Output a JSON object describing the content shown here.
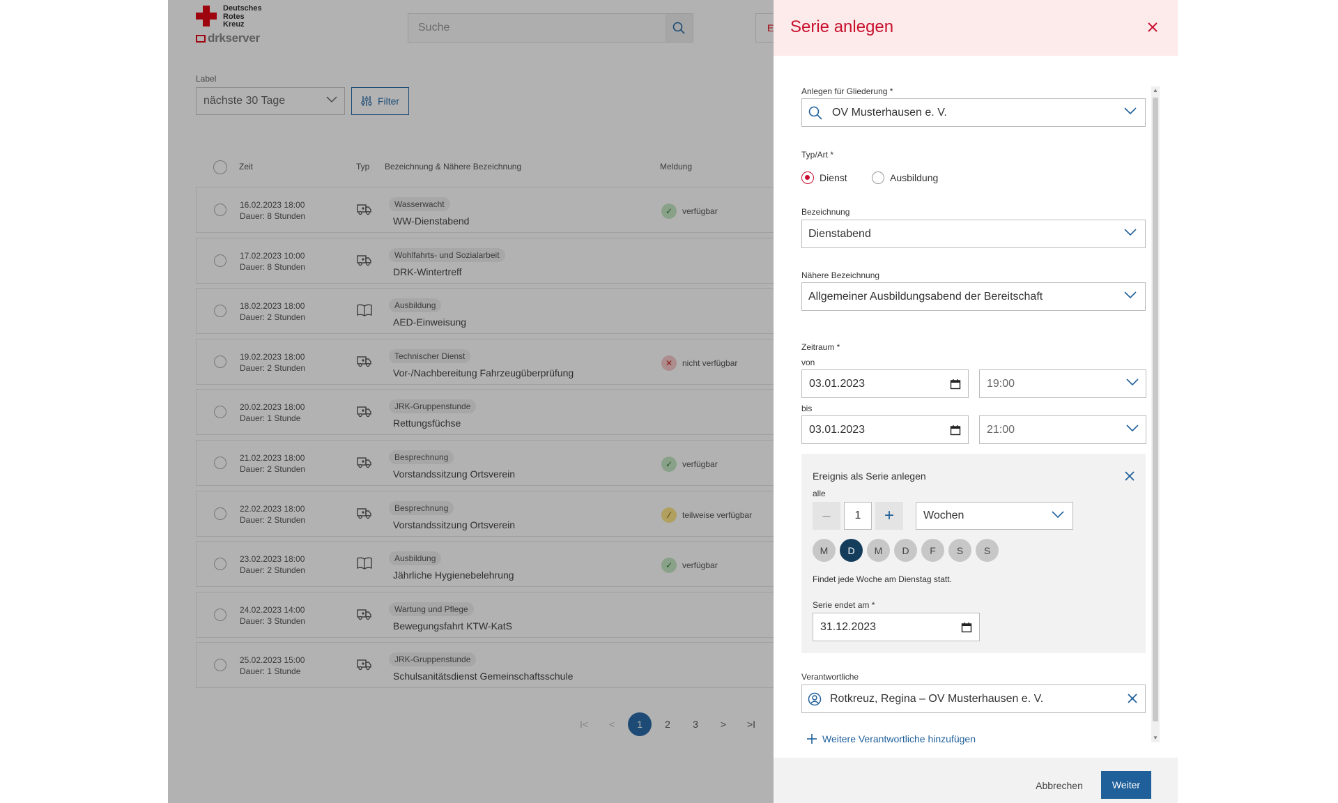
{
  "brand": {
    "org_lines": [
      "Deutsches",
      "Rotes",
      "Kreuz"
    ],
    "product": "drkserver"
  },
  "search": {
    "placeholder": "Suche"
  },
  "list": {
    "filter_label": "Label",
    "range_value": "nächste 30 Tage",
    "filter_button": "Filter",
    "columns": {
      "time": "Zeit",
      "type": "Typ",
      "name": "Bezeichnung & Nähere Bezeichnung",
      "status": "Meldung"
    },
    "rows": [
      {
        "date": "16.02.2023 18:00",
        "duration": "Dauer: 8 Stunden",
        "icon": "truck-icon",
        "tag": "Wasserwacht",
        "name": "WW-Dienstabend",
        "status": "verfügbar",
        "status_kind": "ok"
      },
      {
        "date": "17.02.2023 10:00",
        "duration": "Dauer: 8 Stunden",
        "icon": "truck-icon",
        "tag": "Wohlfahrts- und Sozialarbeit",
        "name": "DRK-Wintertreff",
        "status": "",
        "status_kind": ""
      },
      {
        "date": "18.02.2023 18:00",
        "duration": "Dauer: 2 Stunden",
        "icon": "book-icon",
        "tag": "Ausbildung",
        "name": "AED-Einweisung",
        "status": "",
        "status_kind": ""
      },
      {
        "date": "19.02.2023 18:00",
        "duration": "Dauer: 2 Stunden",
        "icon": "truck-icon",
        "tag": "Technischer Dienst",
        "name": "Vor-/Nachbereitung Fahrzeugüberprüfung",
        "status": "nicht verfügbar",
        "status_kind": "no"
      },
      {
        "date": "20.02.2023 18:00",
        "duration": "Dauer: 1 Stunde",
        "icon": "truck-icon",
        "tag": "JRK-Gruppenstunde",
        "name": "Rettungsfüchse",
        "status": "",
        "status_kind": ""
      },
      {
        "date": "21.02.2023 18:00",
        "duration": "Dauer: 2 Stunden",
        "icon": "truck-icon",
        "tag": "Besprechnung",
        "name": "Vorstandssitzung Ortsverein",
        "status": "verfügbar",
        "status_kind": "ok"
      },
      {
        "date": "22.02.2023 18:00",
        "duration": "Dauer: 2 Stunden",
        "icon": "truck-icon",
        "tag": "Besprechnung",
        "name": "Vorstandssitzung Ortsverein",
        "status": "teilweise verfügbar",
        "status_kind": "part"
      },
      {
        "date": "23.02.2023 18:00",
        "duration": "Dauer: 2 Stunden",
        "icon": "book-icon",
        "tag": "Ausbildung",
        "name": "Jährliche Hygienebelehrung",
        "status": "verfügbar",
        "status_kind": "ok"
      },
      {
        "date": "24.02.2023 14:00",
        "duration": "Dauer: 3 Stunden",
        "icon": "truck-icon",
        "tag": "Wartung und Pflege",
        "name": "Bewegungsfahrt KTW-KatS",
        "status": "",
        "status_kind": ""
      },
      {
        "date": "25.02.2023 15:00",
        "duration": "Dauer: 1 Stunde",
        "icon": "truck-icon",
        "tag": "JRK-Gruppenstunde",
        "name": "Schulsanitätsdienst Gemeinschaftsschule",
        "status": "",
        "status_kind": ""
      }
    ],
    "pagination": {
      "first": "I<",
      "prev": "<",
      "pages": [
        "1",
        "2",
        "3"
      ],
      "active": "1",
      "next": ">",
      "last": ">I"
    }
  },
  "drawer": {
    "title": "Serie anlegen",
    "org": {
      "label": "Anlegen für Gliederung *",
      "value": "OV Musterhausen e. V."
    },
    "type": {
      "label": "Typ/Art *",
      "options": [
        "Dienst",
        "Ausbildung"
      ],
      "selected": "Dienst"
    },
    "designation": {
      "label": "Bezeichnung",
      "value": "Dienstabend"
    },
    "detail": {
      "label": "Nähere Bezeichnung",
      "value": "Allgemeiner Ausbildungsabend der Bereitschaft"
    },
    "period": {
      "label": "Zeitraum *",
      "from_label": "von",
      "from_date": "03.01.2023",
      "from_time": "19:00",
      "to_label": "bis",
      "to_date": "03.01.2023",
      "to_time": "21:00"
    },
    "series": {
      "title": "Ereignis als Serie anlegen",
      "every_label": "alle",
      "interval": "1",
      "minus": "–",
      "plus": "+",
      "unit": "Wochen",
      "days": [
        "M",
        "D",
        "M",
        "D",
        "F",
        "S",
        "S"
      ],
      "active_day_index": 1,
      "summary": "Findet jede Woche am Dienstag statt.",
      "end_label": "Serie endet am *",
      "end_date": "31.12.2023"
    },
    "responsible": {
      "label": "Verantwortliche",
      "value": "Rotkreuz, Regina – OV Musterhausen e. V."
    },
    "add_more": "Weitere Verantwortliche hinzufügen",
    "cancel": "Abbrechen",
    "next": "Weiter"
  }
}
